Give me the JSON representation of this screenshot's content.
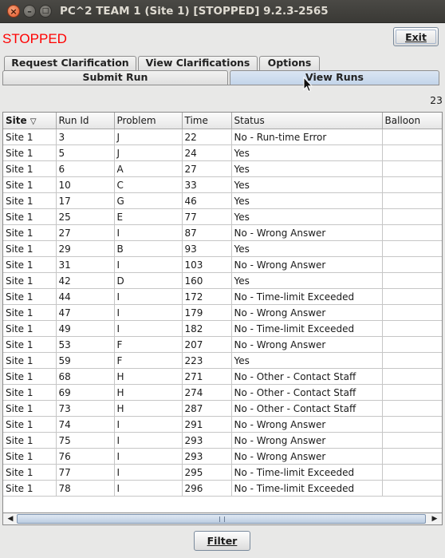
{
  "window": {
    "title": "PC^2 TEAM 1 (Site 1) [STOPPED] 9.2.3-2565",
    "close_glyph": "×",
    "minimize_glyph": "–",
    "maximize_glyph": "□"
  },
  "status_text": "STOPPED",
  "exit_label": "Exit",
  "tabs_row1": [
    {
      "label": "Request Clarification"
    },
    {
      "label": "View Clarifications"
    },
    {
      "label": "Options"
    }
  ],
  "tabs_row2": [
    {
      "label": "Submit Run"
    },
    {
      "label": "View Runs",
      "selected": true
    }
  ],
  "run_count": "23",
  "table": {
    "columns": [
      "Site",
      "Run Id",
      "Problem",
      "Time",
      "Status",
      "Balloon"
    ],
    "sort_indicator": "▽",
    "rows": [
      [
        "Site 1",
        "3",
        "J",
        "22",
        "No - Run-time Error",
        ""
      ],
      [
        "Site 1",
        "5",
        "J",
        "24",
        "Yes",
        ""
      ],
      [
        "Site 1",
        "6",
        "A",
        "27",
        "Yes",
        ""
      ],
      [
        "Site 1",
        "10",
        "C",
        "33",
        "Yes",
        ""
      ],
      [
        "Site 1",
        "17",
        "G",
        "46",
        "Yes",
        ""
      ],
      [
        "Site 1",
        "25",
        "E",
        "77",
        "Yes",
        ""
      ],
      [
        "Site 1",
        "27",
        "I",
        "87",
        "No - Wrong Answer",
        ""
      ],
      [
        "Site 1",
        "29",
        "B",
        "93",
        "Yes",
        ""
      ],
      [
        "Site 1",
        "31",
        "I",
        "103",
        "No - Wrong Answer",
        ""
      ],
      [
        "Site 1",
        "42",
        "D",
        "160",
        "Yes",
        ""
      ],
      [
        "Site 1",
        "44",
        "I",
        "172",
        "No - Time-limit Exceeded",
        ""
      ],
      [
        "Site 1",
        "47",
        "I",
        "179",
        "No - Wrong Answer",
        ""
      ],
      [
        "Site 1",
        "49",
        "I",
        "182",
        "No - Time-limit Exceeded",
        ""
      ],
      [
        "Site 1",
        "53",
        "F",
        "207",
        "No - Wrong Answer",
        ""
      ],
      [
        "Site 1",
        "59",
        "F",
        "223",
        "Yes",
        ""
      ],
      [
        "Site 1",
        "68",
        "H",
        "271",
        "No - Other - Contact Staff",
        ""
      ],
      [
        "Site 1",
        "69",
        "H",
        "274",
        "No - Other - Contact Staff",
        ""
      ],
      [
        "Site 1",
        "73",
        "H",
        "287",
        "No - Other - Contact Staff",
        ""
      ],
      [
        "Site 1",
        "74",
        "I",
        "291",
        "No - Wrong Answer",
        ""
      ],
      [
        "Site 1",
        "75",
        "I",
        "293",
        "No - Wrong Answer",
        ""
      ],
      [
        "Site 1",
        "76",
        "I",
        "293",
        "No - Wrong Answer",
        ""
      ],
      [
        "Site 1",
        "77",
        "I",
        "295",
        "No - Time-limit Exceeded",
        ""
      ],
      [
        "Site 1",
        "78",
        "I",
        "296",
        "No - Time-limit Exceeded",
        ""
      ]
    ]
  },
  "scroll": {
    "left_arrow": "◀",
    "right_arrow": "▶"
  },
  "filter_label": "Filter",
  "colors": {
    "status_stopped": "#ff0000",
    "selected_tab": "#c3d5ea",
    "titlebar": "#3c3b37"
  }
}
